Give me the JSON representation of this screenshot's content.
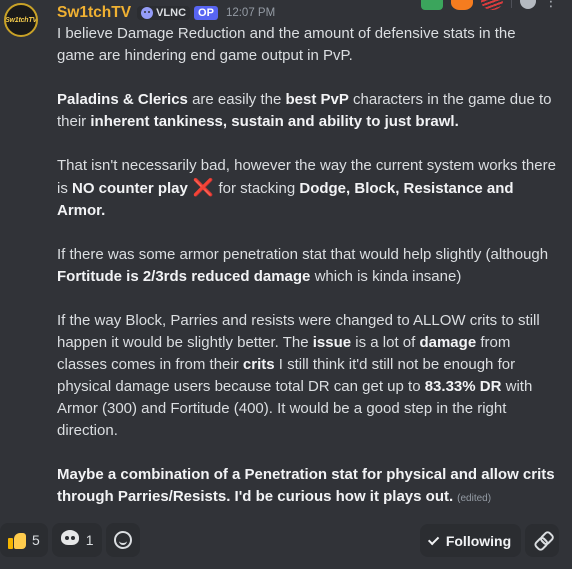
{
  "message": {
    "avatar_text": "Sw1tchTV",
    "username": "Sw1tchTV",
    "tag": "VLNC",
    "op_badge": "OP",
    "timestamp": "12:07 PM",
    "edited": "(edited)",
    "paragraphs": [
      [
        {
          "t": "I believe Damage Reduction and the amount of defensive stats in the game are hindering end game output in PvP.",
          "b": false
        }
      ],
      [
        {
          "t": "Paladins & Clerics",
          "b": true
        },
        {
          "t": " are easily the ",
          "b": false
        },
        {
          "t": "best PvP",
          "b": true
        },
        {
          "t": " characters in the game due to their ",
          "b": false
        },
        {
          "t": "inherent tankiness, sustain and ability to just brawl.",
          "b": true
        }
      ],
      [
        {
          "t": "That isn't necessarily bad, however the way the current system works there is ",
          "b": false
        },
        {
          "t": "NO  counter play",
          "b": true
        },
        {
          "t": " ❌ ",
          "x": true
        },
        {
          "t": "for stacking ",
          "b": false
        },
        {
          "t": "Dodge, Block, Resistance and Armor.",
          "b": true
        }
      ],
      [
        {
          "t": "If there was some armor penetration stat that would help slightly (although ",
          "b": false
        },
        {
          "t": "Fortitude is 2/3rds reduced damage",
          "b": true
        },
        {
          "t": " which is kinda insane)",
          "b": false
        }
      ],
      [
        {
          "t": "If the way Block, Parries and resists were changed to ALLOW crits to still happen it would be slightly better. The ",
          "b": false
        },
        {
          "t": "issue",
          "b": true
        },
        {
          "t": " is a lot of ",
          "b": false
        },
        {
          "t": "damage",
          "b": true
        },
        {
          "t": " from classes comes in from their ",
          "b": false
        },
        {
          "t": "crits",
          "b": true
        },
        {
          "t": " I still think it'd still not be enough for physical damage users because total DR can get up to ",
          "b": false
        },
        {
          "t": "83.33% DR",
          "b": true
        },
        {
          "t": " with Armor (300) and Fortitude (400). It would be a good step in the right direction.",
          "b": false
        }
      ],
      [
        {
          "t": "Maybe a combination of a Penetration stat for physical and allow crits through Parries/Resists. I'd be curious how it plays out.",
          "b": true
        }
      ]
    ]
  },
  "reactions": [
    {
      "icon": "thumbs-up-icon",
      "count": "5"
    },
    {
      "icon": "skull-icon",
      "count": "1"
    }
  ],
  "actions": {
    "following_label": "Following"
  },
  "hover_bar": [
    "check-icon",
    "fire-icon",
    "wave-icon",
    "emoji-icon",
    "more-icon"
  ]
}
